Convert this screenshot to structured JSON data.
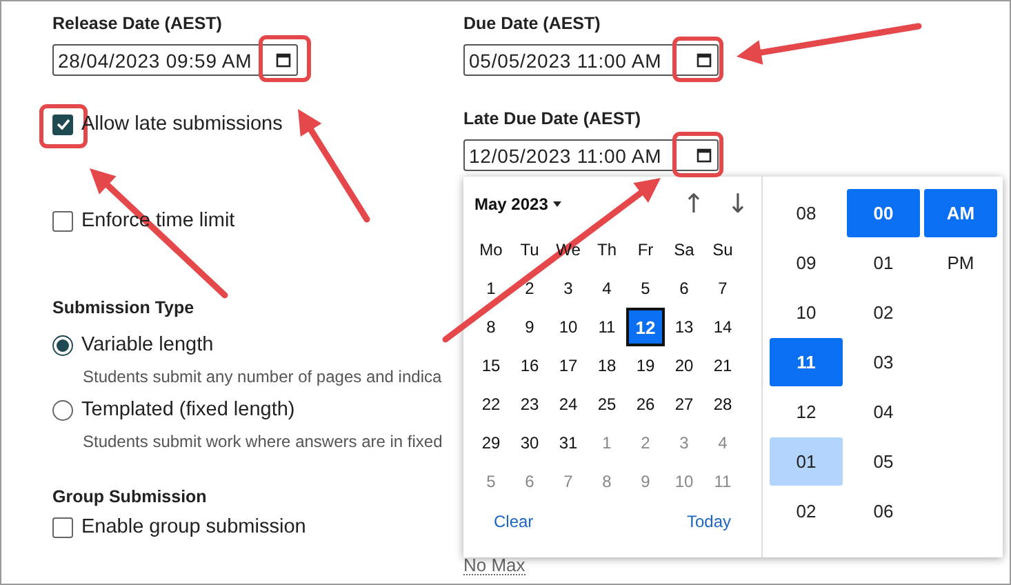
{
  "date_fields": [
    {
      "label": "Release Date (AEST)",
      "value": "28/04/2023 09:59 AM"
    },
    {
      "label": "Due Date (AEST)",
      "value": "05/05/2023 11:00 AM"
    },
    {
      "label": "Late Due Date (AEST)",
      "value": "12/05/2023 11:00 AM"
    }
  ],
  "checkboxes": [
    {
      "label": "Allow late submissions",
      "checked": true
    },
    {
      "label": "Enforce time limit",
      "checked": false
    }
  ],
  "submission_type": {
    "title": "Submission Type",
    "options": [
      {
        "label": "Variable length",
        "description": "Students submit any number of pages and indica",
        "selected": true
      },
      {
        "label": "Templated (fixed length)",
        "description": "Students submit work where answers are in fixed",
        "selected": false
      }
    ]
  },
  "group_submission": {
    "title": "Group Submission",
    "checkbox": {
      "label": "Enable group submission",
      "checked": false
    }
  },
  "max_text": "No Max",
  "date_picker": {
    "month": "May 2023",
    "prev": "↑",
    "next": "↓",
    "weekdays": [
      "Mo",
      "Tu",
      "We",
      "Th",
      "Fr",
      "Sa",
      "Su"
    ],
    "days": [
      {
        "label": "1",
        "outside": false,
        "selected": false
      },
      {
        "label": "2",
        "outside": false,
        "selected": false
      },
      {
        "label": "3",
        "outside": false,
        "selected": false
      },
      {
        "label": "4",
        "outside": false,
        "selected": false
      },
      {
        "label": "5",
        "outside": false,
        "selected": false
      },
      {
        "label": "6",
        "outside": false,
        "selected": false
      },
      {
        "label": "7",
        "outside": false,
        "selected": false
      },
      {
        "label": "8",
        "outside": false,
        "selected": false
      },
      {
        "label": "9",
        "outside": false,
        "selected": false
      },
      {
        "label": "10",
        "outside": false,
        "selected": false
      },
      {
        "label": "11",
        "outside": false,
        "selected": false
      },
      {
        "label": "12",
        "outside": false,
        "selected": true
      },
      {
        "label": "13",
        "outside": false,
        "selected": false
      },
      {
        "label": "14",
        "outside": false,
        "selected": false
      },
      {
        "label": "15",
        "outside": false,
        "selected": false
      },
      {
        "label": "16",
        "outside": false,
        "selected": false
      },
      {
        "label": "17",
        "outside": false,
        "selected": false
      },
      {
        "label": "18",
        "outside": false,
        "selected": false
      },
      {
        "label": "19",
        "outside": false,
        "selected": false
      },
      {
        "label": "20",
        "outside": false,
        "selected": false
      },
      {
        "label": "21",
        "outside": false,
        "selected": false
      },
      {
        "label": "22",
        "outside": false,
        "selected": false
      },
      {
        "label": "23",
        "outside": false,
        "selected": false
      },
      {
        "label": "24",
        "outside": false,
        "selected": false
      },
      {
        "label": "25",
        "outside": false,
        "selected": false
      },
      {
        "label": "26",
        "outside": false,
        "selected": false
      },
      {
        "label": "27",
        "outside": false,
        "selected": false
      },
      {
        "label": "28",
        "outside": false,
        "selected": false
      },
      {
        "label": "29",
        "outside": false,
        "selected": false
      },
      {
        "label": "30",
        "outside": false,
        "selected": false
      },
      {
        "label": "31",
        "outside": false,
        "selected": false
      },
      {
        "label": "1",
        "outside": true,
        "selected": false
      },
      {
        "label": "2",
        "outside": true,
        "selected": false
      },
      {
        "label": "3",
        "outside": true,
        "selected": false
      },
      {
        "label": "4",
        "outside": true,
        "selected": false
      },
      {
        "label": "5",
        "outside": true,
        "selected": false
      },
      {
        "label": "6",
        "outside": true,
        "selected": false
      },
      {
        "label": "7",
        "outside": true,
        "selected": false
      },
      {
        "label": "8",
        "outside": true,
        "selected": false
      },
      {
        "label": "9",
        "outside": true,
        "selected": false
      },
      {
        "label": "10",
        "outside": true,
        "selected": false
      },
      {
        "label": "11",
        "outside": true,
        "selected": false
      }
    ],
    "clear": "Clear",
    "today": "Today",
    "hours": [
      {
        "label": "08",
        "selected": false,
        "highlighted": false
      },
      {
        "label": "09",
        "selected": false,
        "highlighted": false
      },
      {
        "label": "10",
        "selected": false,
        "highlighted": false
      },
      {
        "label": "11",
        "selected": true,
        "highlighted": false
      },
      {
        "label": "12",
        "selected": false,
        "highlighted": false
      },
      {
        "label": "01",
        "selected": false,
        "highlighted": true
      },
      {
        "label": "02",
        "selected": false,
        "highlighted": false
      }
    ],
    "minutes": [
      {
        "label": "00",
        "selected": true
      },
      {
        "label": "01",
        "selected": false
      },
      {
        "label": "02",
        "selected": false
      },
      {
        "label": "03",
        "selected": false
      },
      {
        "label": "04",
        "selected": false
      },
      {
        "label": "05",
        "selected": false
      },
      {
        "label": "06",
        "selected": false
      }
    ],
    "periods": [
      {
        "label": "AM",
        "selected": true
      },
      {
        "label": "PM",
        "selected": false
      }
    ]
  }
}
